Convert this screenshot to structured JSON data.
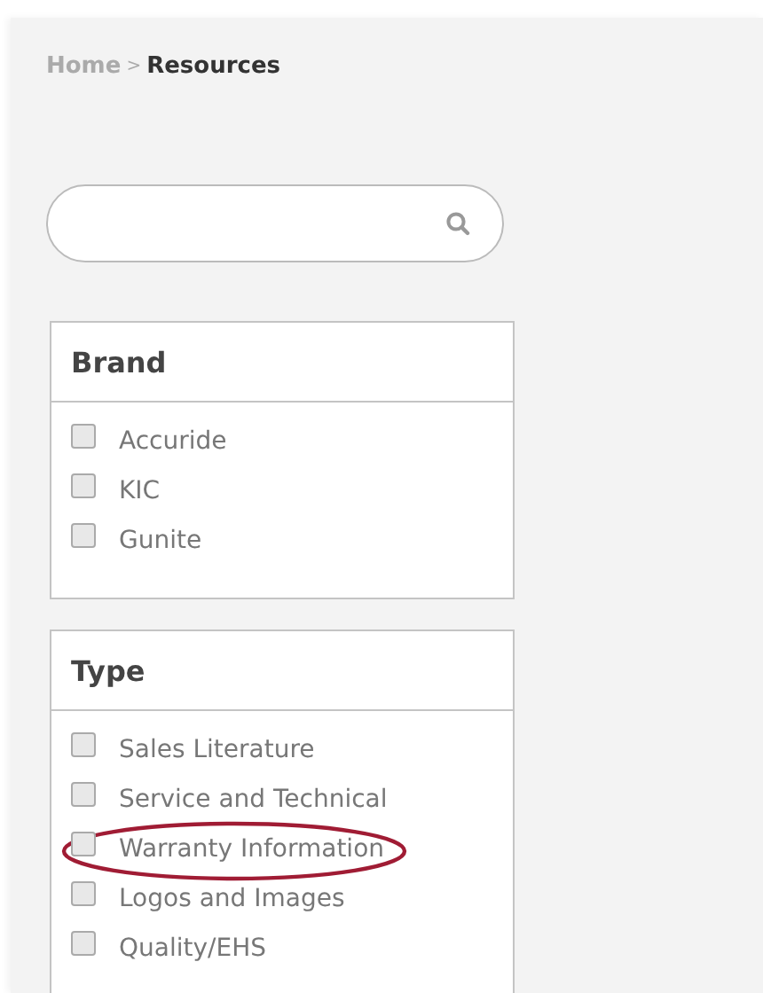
{
  "breadcrumb": [
    {
      "label": "Home",
      "current": false
    },
    {
      "label": "Resources",
      "current": true
    }
  ],
  "breadcrumb_separator": ">",
  "filters": [
    {
      "title": "Brand",
      "options": [
        {
          "label": "Accuride",
          "checked": false,
          "highlighted": false
        },
        {
          "label": "KIC",
          "checked": false,
          "highlighted": false
        },
        {
          "label": "Gunite",
          "checked": false,
          "highlighted": false
        }
      ]
    },
    {
      "title": "Type",
      "options": [
        {
          "label": "Sales Literature",
          "checked": false,
          "highlighted": false
        },
        {
          "label": "Service and Technical",
          "checked": false,
          "highlighted": false
        },
        {
          "label": "Warranty Information",
          "checked": false,
          "highlighted": true
        },
        {
          "label": "Logos and Images",
          "checked": false,
          "highlighted": false
        },
        {
          "label": "Quality/EHS",
          "checked": false,
          "highlighted": false
        }
      ]
    }
  ]
}
